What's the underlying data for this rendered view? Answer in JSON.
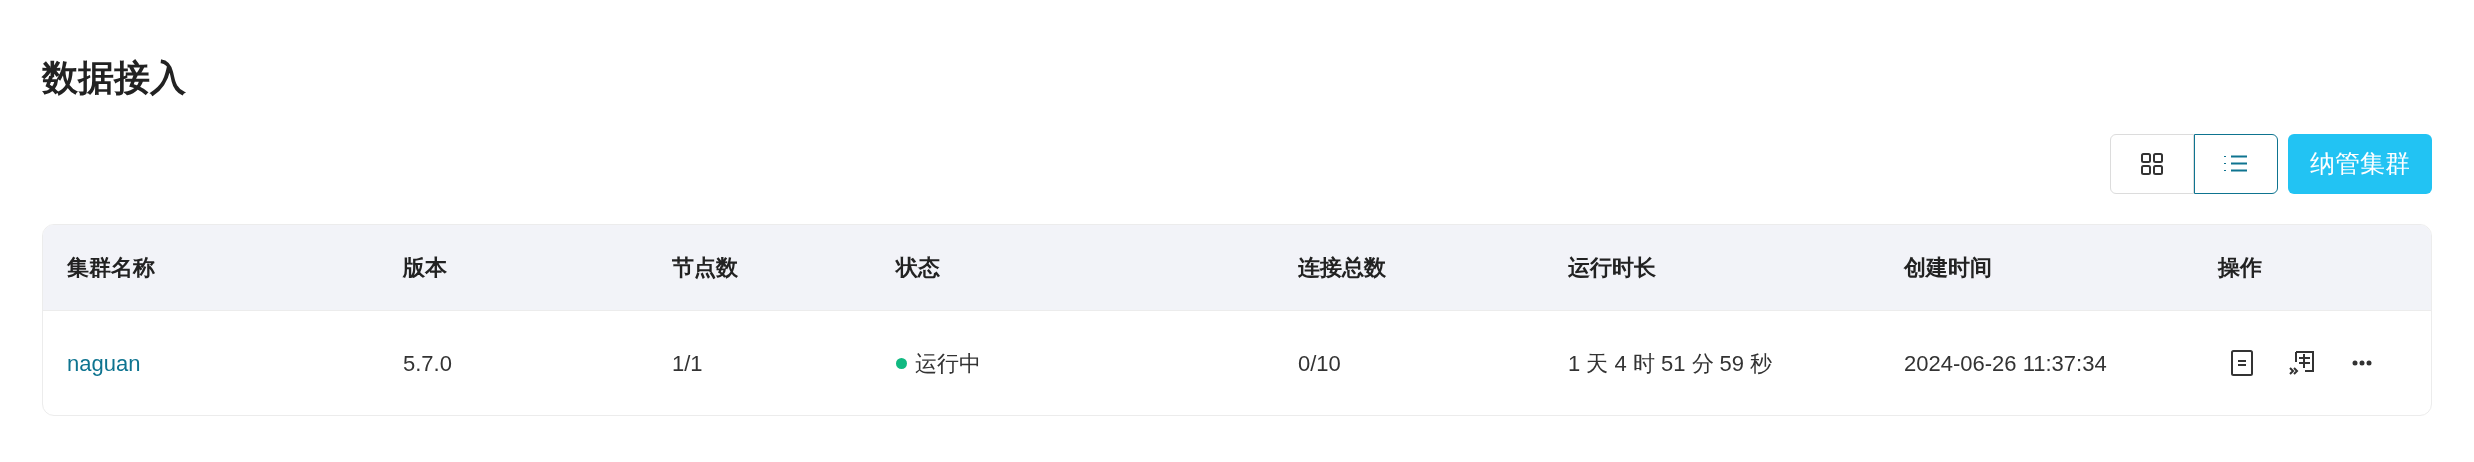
{
  "page_title": "数据接入",
  "view_toggle": [
    {
      "kind": "grid",
      "selected": false
    },
    {
      "kind": "list",
      "selected": true
    }
  ],
  "primary_button": "纳管集群",
  "table": {
    "columns": [
      "集群名称",
      "版本",
      "节点数",
      "状态",
      "连接总数",
      "运行时长",
      "创建时间",
      "操作"
    ],
    "rows": [
      {
        "name": "naguan",
        "version": "5.7.0",
        "nodes": "1/1",
        "status": {
          "label": "运行中",
          "color": "#10b981"
        },
        "connections": "0/10",
        "uptime": "1 天 4 时 51 分 59 秒",
        "created": "2024-06-26 11:37:34",
        "actions": [
          {
            "kind": "detail"
          },
          {
            "kind": "migrate"
          },
          {
            "kind": "more"
          }
        ]
      }
    ]
  }
}
